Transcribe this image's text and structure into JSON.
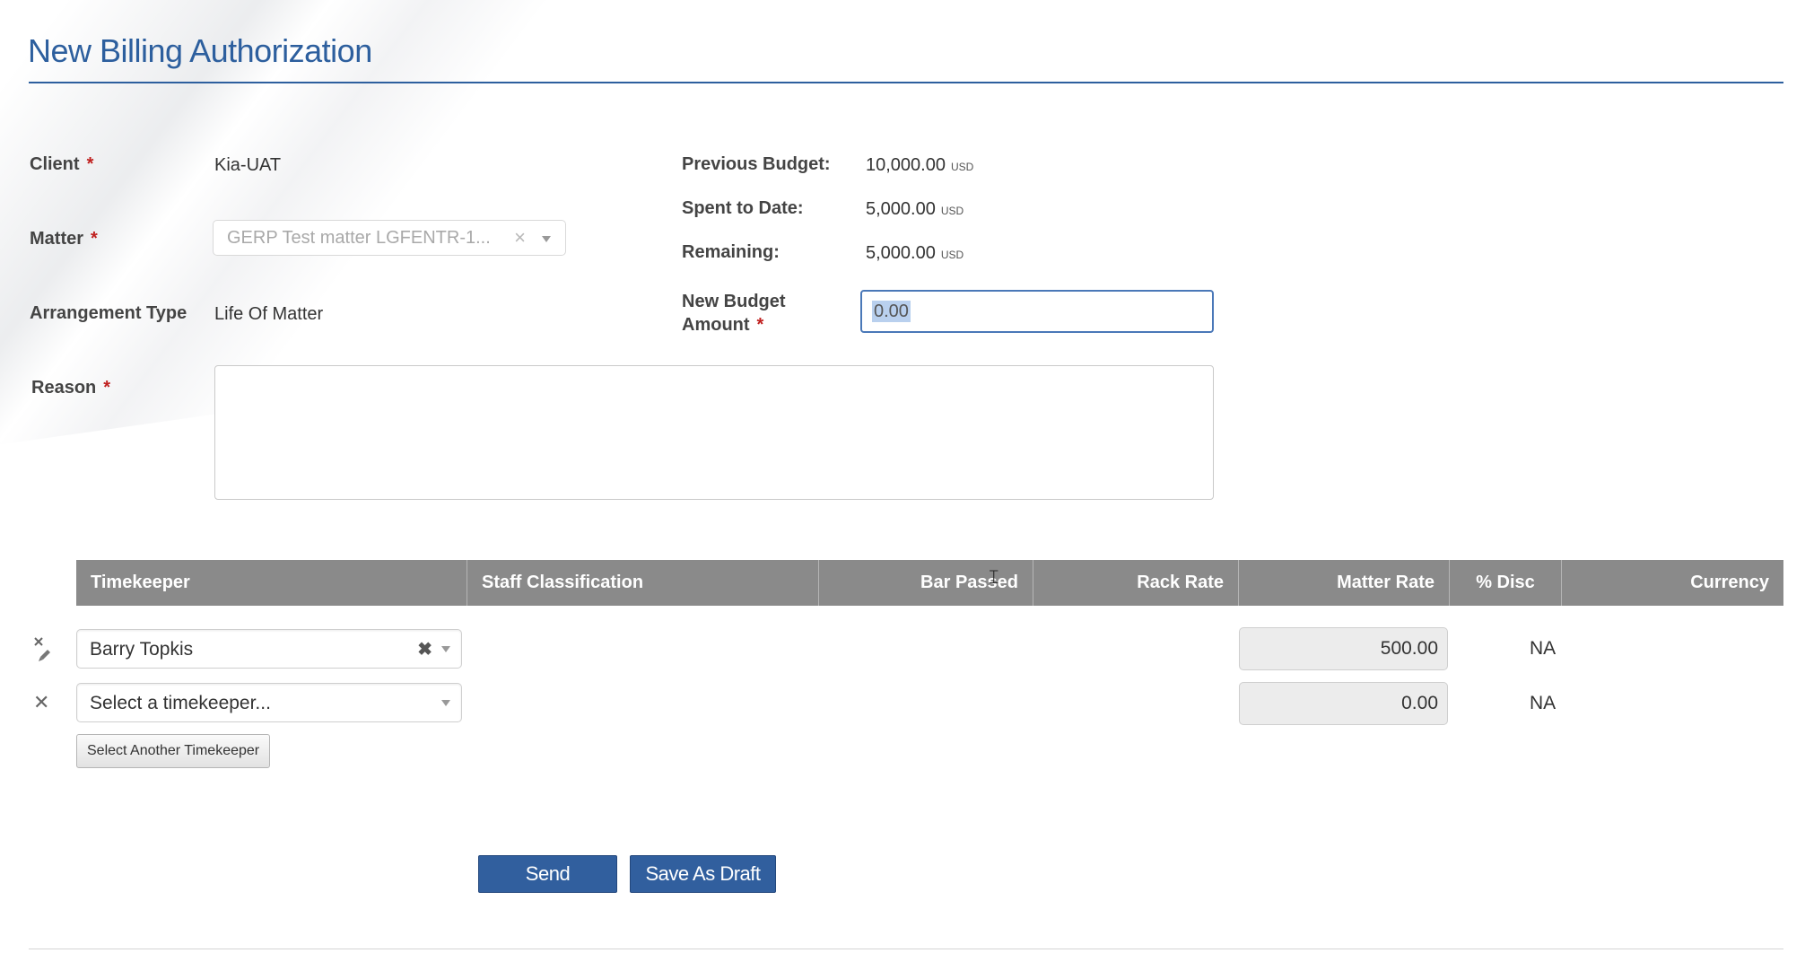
{
  "page": {
    "title": "New Billing Authorization"
  },
  "form": {
    "client": {
      "label": "Client",
      "value": "Kia-UAT"
    },
    "matter": {
      "label": "Matter",
      "value": "GERP Test matter LGFENTR-1..."
    },
    "arrangement": {
      "label": "Arrangement Type",
      "value": "Life Of Matter"
    },
    "reason": {
      "label": "Reason",
      "value": ""
    },
    "required_mark": "*"
  },
  "budget": {
    "previous": {
      "label": "Previous Budget:",
      "value": "10,000.00",
      "currency": "USD"
    },
    "spent": {
      "label": "Spent to Date:",
      "value": "5,000.00",
      "currency": "USD"
    },
    "remaining": {
      "label": "Remaining:",
      "value": "5,000.00",
      "currency": "USD"
    },
    "new_amount": {
      "label_line1": "New Budget",
      "label_line2": "Amount",
      "value": "0.00"
    }
  },
  "table": {
    "columns": [
      "Timekeeper",
      "Staff Classification",
      "Bar Passed",
      "Rack Rate",
      "Matter Rate",
      "% Disc",
      "Currency"
    ],
    "rows": [
      {
        "timekeeper": "Barry Topkis",
        "matter_rate": "500.00",
        "disc": "NA"
      },
      {
        "timekeeper": "Select a timekeeper...",
        "matter_rate": "0.00",
        "disc": "NA"
      }
    ],
    "add_button": "Select Another Timekeeper"
  },
  "actions": {
    "send": "Send",
    "save_draft": "Save As Draft"
  },
  "colors": {
    "accent": "#2d5f9e",
    "header_bg": "#8a8a8a",
    "required": "#c0201f"
  }
}
